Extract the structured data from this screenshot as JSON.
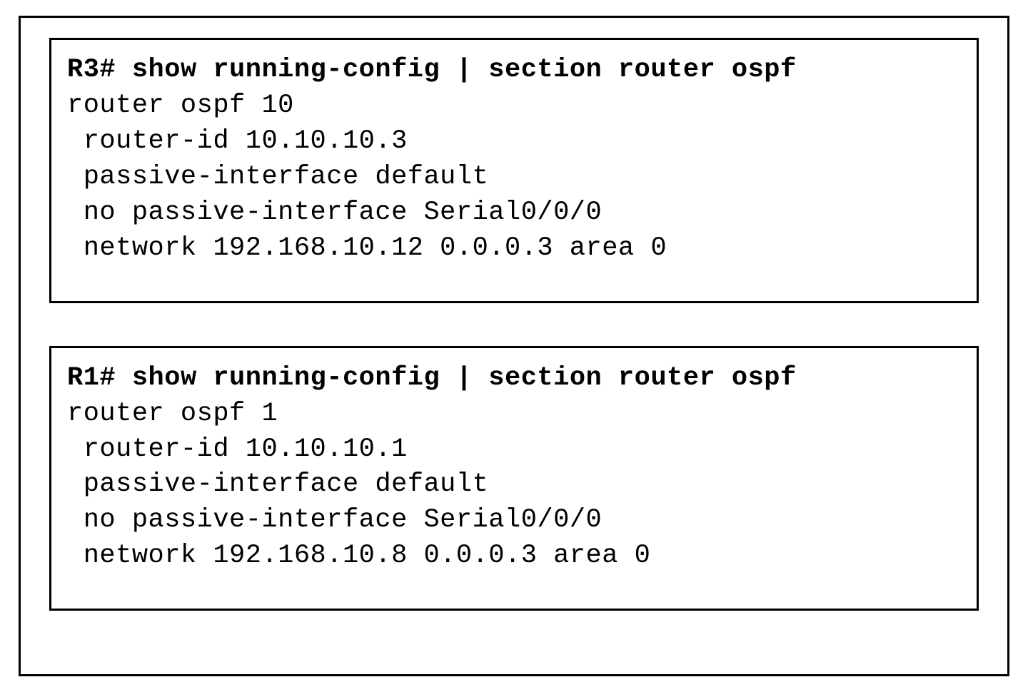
{
  "boxes": [
    {
      "prompt": "R3# ",
      "command": "show running-config | section router ospf",
      "output": [
        "router ospf 10",
        " router-id 10.10.10.3",
        " passive-interface default",
        " no passive-interface Serial0/0/0",
        " network 192.168.10.12 0.0.0.3 area 0"
      ]
    },
    {
      "prompt": "R1# ",
      "command": "show running-config | section router ospf",
      "output": [
        "router ospf 1",
        " router-id 10.10.10.1",
        " passive-interface default",
        " no passive-interface Serial0/0/0",
        " network 192.168.10.8 0.0.0.3 area 0"
      ]
    }
  ]
}
